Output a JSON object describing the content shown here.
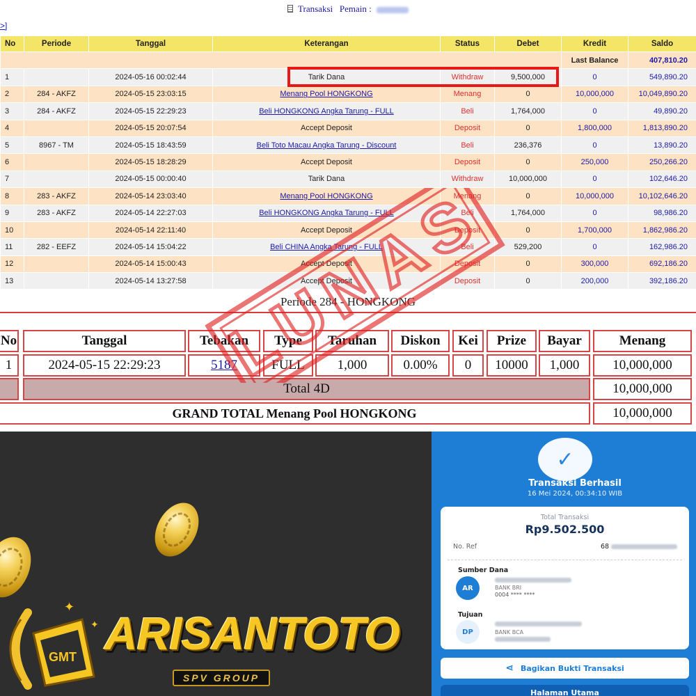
{
  "header": {
    "title": "Transaksi",
    "player_label": "Pemain :",
    "nav": ">]"
  },
  "columns": [
    "No",
    "Periode",
    "Tanggal",
    "Keterangan",
    "Status",
    "Debet",
    "Kredit",
    "Saldo"
  ],
  "last_balance": {
    "label": "Last Balance",
    "value": "407,810.20"
  },
  "rows": [
    {
      "no": "1",
      "periode": "",
      "tanggal": "2024-05-16 00:02:44",
      "keterangan": "Tarik Dana",
      "status": "Withdraw",
      "debet": "9,500,000",
      "kredit": "0",
      "saldo": "549,890.20",
      "link": false
    },
    {
      "no": "2",
      "periode": "284 - AKFZ",
      "tanggal": "2024-05-15 23:03:15",
      "keterangan": "Menang Pool HONGKONG",
      "status": "Menang",
      "debet": "0",
      "kredit": "10,000,000",
      "saldo": "10,049,890.20",
      "link": true
    },
    {
      "no": "3",
      "periode": "284 - AKFZ",
      "tanggal": "2024-05-15 22:29:23",
      "keterangan": "Beli HONGKONG Angka Tarung - FULL",
      "status": "Beli",
      "debet": "1,764,000",
      "kredit": "0",
      "saldo": "49,890.20",
      "link": true
    },
    {
      "no": "4",
      "periode": "",
      "tanggal": "2024-05-15 20:07:54",
      "keterangan": "Accept Deposit",
      "status": "Deposit",
      "debet": "0",
      "kredit": "1,800,000",
      "saldo": "1,813,890.20",
      "link": false
    },
    {
      "no": "5",
      "periode": "8967 - TM",
      "tanggal": "2024-05-15 18:43:59",
      "keterangan": "Beli Toto Macau Angka Tarung - Discount",
      "status": "Beli",
      "debet": "236,376",
      "kredit": "0",
      "saldo": "13,890.20",
      "link": true
    },
    {
      "no": "6",
      "periode": "",
      "tanggal": "2024-05-15 18:28:29",
      "keterangan": "Accept Deposit",
      "status": "Deposit",
      "debet": "0",
      "kredit": "250,000",
      "saldo": "250,266.20",
      "link": false
    },
    {
      "no": "7",
      "periode": "",
      "tanggal": "2024-05-15 00:00:40",
      "keterangan": "Tarik Dana",
      "status": "Withdraw",
      "debet": "10,000,000",
      "kredit": "0",
      "saldo": "102,646.20",
      "link": false
    },
    {
      "no": "8",
      "periode": "283 - AKFZ",
      "tanggal": "2024-05-14 23:03:40",
      "keterangan": "Menang Pool HONGKONG",
      "status": "Menang",
      "debet": "0",
      "kredit": "10,000,000",
      "saldo": "10,102,646.20",
      "link": true
    },
    {
      "no": "9",
      "periode": "283 - AKFZ",
      "tanggal": "2024-05-14 22:27:03",
      "keterangan": "Beli HONGKONG Angka Tarung - FULL",
      "status": "Beli",
      "debet": "1,764,000",
      "kredit": "0",
      "saldo": "98,986.20",
      "link": true
    },
    {
      "no": "10",
      "periode": "",
      "tanggal": "2024-05-14 22:11:40",
      "keterangan": "Accept Deposit",
      "status": "Deposit",
      "debet": "0",
      "kredit": "1,700,000",
      "saldo": "1,862,986.20",
      "link": false
    },
    {
      "no": "11",
      "periode": "282 - EEFZ",
      "tanggal": "2024-05-14 15:04:22",
      "keterangan": "Beli CHINA Angka Tarung - FULL",
      "status": "Beli",
      "debet": "529,200",
      "kredit": "0",
      "saldo": "162,986.20",
      "link": true
    },
    {
      "no": "12",
      "periode": "",
      "tanggal": "2024-05-14 15:00:43",
      "keterangan": "Accept Deposit",
      "status": "Deposit",
      "debet": "0",
      "kredit": "300,000",
      "saldo": "692,186.20",
      "link": false
    },
    {
      "no": "13",
      "periode": "",
      "tanggal": "2024-05-14 13:27:58",
      "keterangan": "Accept Deposit",
      "status": "Deposit",
      "debet": "0",
      "kredit": "200,000",
      "saldo": "392,186.20",
      "link": false
    }
  ],
  "detail": {
    "title": "Periode 284 - HONGKONG",
    "headers": [
      "No",
      "Tanggal",
      "Tebakan",
      "Type",
      "Taruhan",
      "Diskon",
      "Kei",
      "Prize",
      "Bayar",
      "Menang"
    ],
    "row": [
      "1",
      "2024-05-15 22:29:23",
      "5187",
      "FULL",
      "1,000",
      "0.00%",
      "0",
      "10000",
      "1,000",
      "10,000,000"
    ],
    "total_label": "Total 4D",
    "total_value": "10,000,000",
    "grand_label": "GRAND TOTAL  Menang Pool HONGKONG",
    "grand_value": "10,000,000"
  },
  "stamp_text": "LUNAS",
  "brand": {
    "name": "ARISANTOTO",
    "tagline": "SPV GROUP",
    "emblem_text": "GMT"
  },
  "receipt": {
    "title": "Transaksi Berhasil",
    "date": "16 Mei 2024, 00:34:10 WIB",
    "total_label": "Total Transaksi",
    "amount": "Rp9.502.500",
    "noref_label": "No. Ref",
    "noref_value": "68",
    "source_label": "Sumber Dana",
    "source_initials": "AR",
    "source_bank": "BANK BRI",
    "source_account": "0004 **** **** ",
    "dest_label": "Tujuan",
    "dest_initials": "DP",
    "dest_bank": "BANK BCA",
    "share_label": "Bagikan Bukti Transaksi",
    "home_label": "Halaman Utama"
  },
  "colors": {
    "accent_red": "#e81818",
    "link_blue": "#1a1aa6",
    "header_yellow": "#f5e566",
    "receipt_blue": "#1e7ed6",
    "brand_gold": "#f6c623"
  }
}
